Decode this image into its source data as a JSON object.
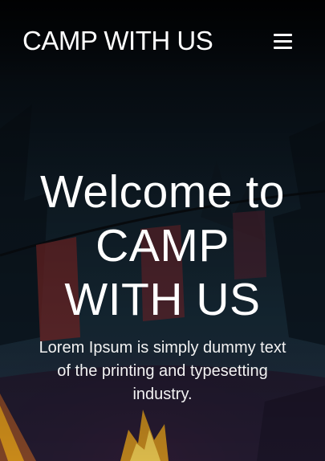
{
  "header": {
    "brand": "CAMP WITH US",
    "menu_icon": "hamburger-menu-icon"
  },
  "hero": {
    "title": "Welcome to CAMP WITH US",
    "subtitle": "Lorem Ipsum is simply dummy text of the printing and typesetting industry."
  },
  "colors": {
    "text": "#ffffff",
    "background": "#0d1722",
    "flag_red": "#8e2f2f",
    "fire_orange": "#e8a21c"
  }
}
